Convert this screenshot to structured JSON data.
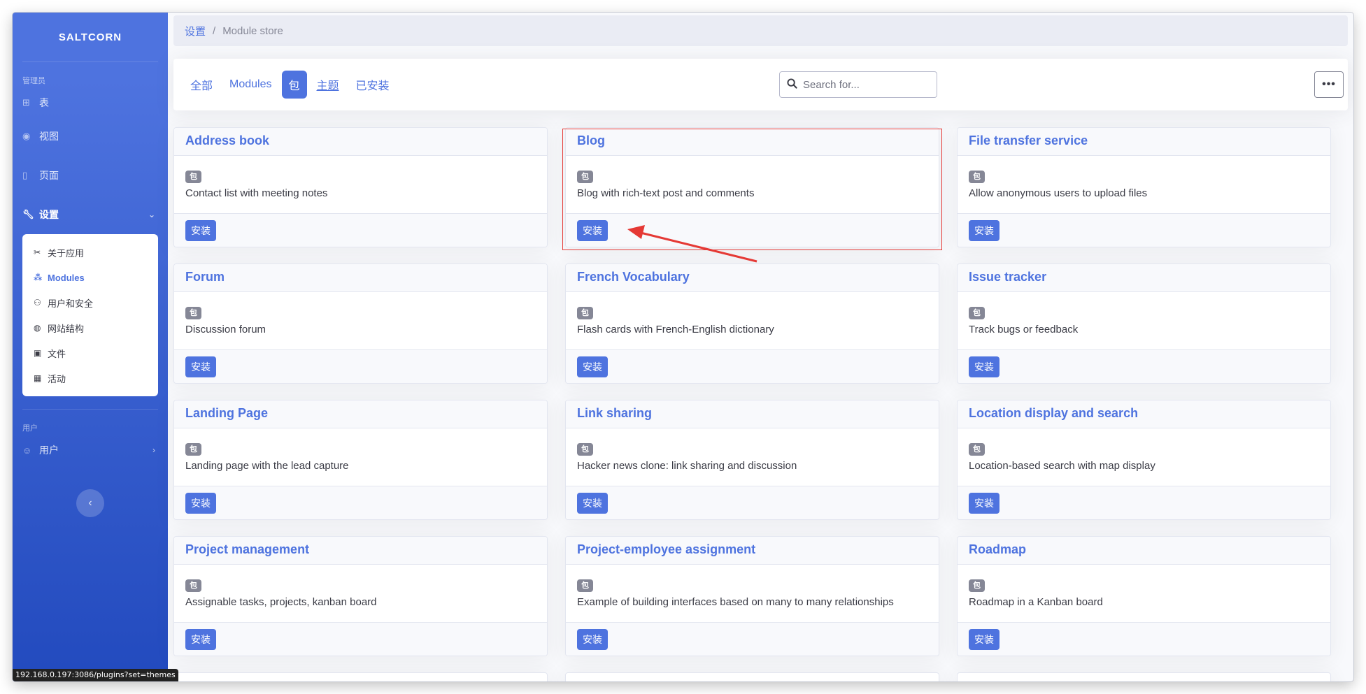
{
  "sidebar": {
    "brand": "SALTCORN",
    "admin_heading": "管理员",
    "users_heading": "用户",
    "items": {
      "tables": "表",
      "views": "视图",
      "pages": "页面",
      "settings": "设置",
      "users": "用户"
    },
    "submenu": [
      {
        "label": "关于应用",
        "icon": "tools-icon"
      },
      {
        "label": "Modules",
        "icon": "cubes-icon"
      },
      {
        "label": "用户和安全",
        "icon": "users-cog-icon"
      },
      {
        "label": "网站结构",
        "icon": "compass-icon"
      },
      {
        "label": "文件",
        "icon": "images-icon"
      },
      {
        "label": "活动",
        "icon": "calendar-check-icon"
      }
    ]
  },
  "status_url": "192.168.0.197:3086/plugins?set=themes",
  "breadcrumb": {
    "parent": "设置",
    "current": "Module store"
  },
  "filter_tabs": [
    {
      "label": "全部",
      "active": false,
      "underline": false
    },
    {
      "label": "Modules",
      "active": false,
      "underline": false
    },
    {
      "label": "包",
      "active": true,
      "underline": false
    },
    {
      "label": "主题",
      "active": false,
      "underline": true
    },
    {
      "label": "已安装",
      "active": false,
      "underline": false
    }
  ],
  "search": {
    "placeholder": "Search for..."
  },
  "more_label": "•••",
  "badge_label": "包",
  "install_label": "安装",
  "modules": [
    {
      "name": "Address book",
      "description": "Contact list with meeting notes"
    },
    {
      "name": "Blog",
      "description": "Blog with rich-text post and comments"
    },
    {
      "name": "File transfer service",
      "description": "Allow anonymous users to upload files"
    },
    {
      "name": "Forum",
      "description": "Discussion forum"
    },
    {
      "name": "French Vocabulary",
      "description": "Flash cards with French-English dictionary"
    },
    {
      "name": "Issue tracker",
      "description": "Track bugs or feedback"
    },
    {
      "name": "Landing Page",
      "description": "Landing page with the lead capture"
    },
    {
      "name": "Link sharing",
      "description": "Hacker news clone: link sharing and discussion"
    },
    {
      "name": "Location display and search",
      "description": "Location-based search with map display"
    },
    {
      "name": "Project management",
      "description": "Assignable tasks, projects, kanban board"
    },
    {
      "name": "Project-employee assignment",
      "description": "Example of building interfaces based on many to many relationships"
    },
    {
      "name": "Roadmap",
      "description": "Roadmap in a Kanban board"
    }
  ],
  "colors": {
    "primary": "#4e73df",
    "annotation": "#e53935"
  }
}
